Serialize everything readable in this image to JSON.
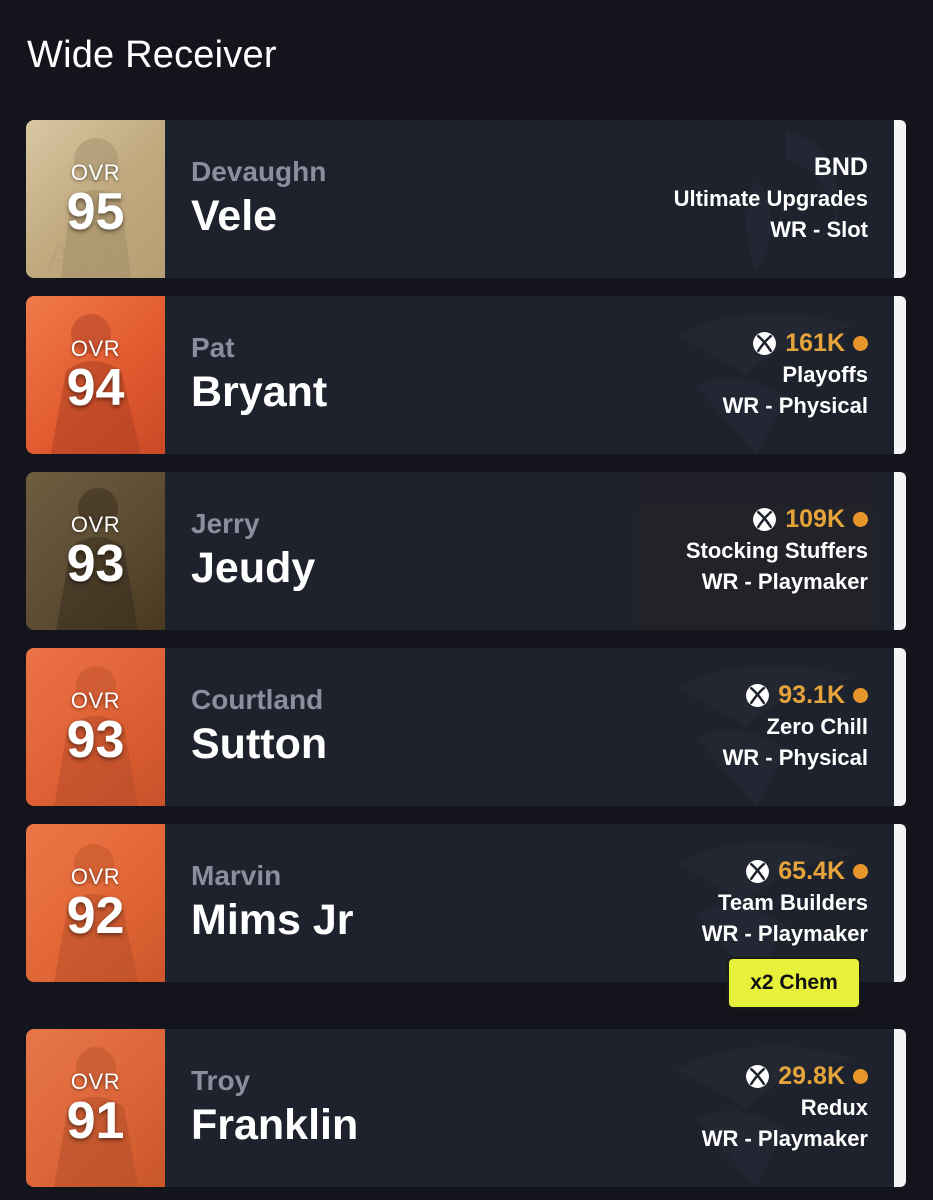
{
  "section_title": "Wide Receiver",
  "ovr_label": "OVR",
  "players": [
    {
      "ovr": "95",
      "first_name": "Devaughn",
      "last_name": "Vele",
      "top_text": "BND",
      "program": "Ultimate Upgrades",
      "archetype": "WR - Slot",
      "art_color": "#cbb793"
    },
    {
      "ovr": "94",
      "first_name": "Pat",
      "last_name": "Bryant",
      "price": "161K",
      "platform_icon": "xbox-icon",
      "currency_icon": "coin-icon",
      "program": "Playoffs",
      "archetype": "WR - Physical",
      "art_color": "#e8623a"
    },
    {
      "ovr": "93",
      "first_name": "Jerry",
      "last_name": "Jeudy",
      "price": "109K",
      "platform_icon": "xbox-icon",
      "currency_icon": "coin-icon",
      "program": "Stocking Stuffers",
      "archetype": "WR - Playmaker",
      "art_color": "#6c5a3e"
    },
    {
      "ovr": "93",
      "first_name": "Courtland",
      "last_name": "Sutton",
      "price": "93.1K",
      "platform_icon": "xbox-icon",
      "currency_icon": "coin-icon",
      "program": "Zero Chill",
      "archetype": "WR - Physical",
      "art_color": "#e06438"
    },
    {
      "ovr": "92",
      "first_name": "Marvin",
      "last_name": "Mims Jr",
      "price": "65.4K",
      "platform_icon": "xbox-icon",
      "currency_icon": "coin-icon",
      "program": "Team Builders",
      "archetype": "WR - Playmaker",
      "badge": "x2 Chem",
      "art_color": "#e26a35"
    },
    {
      "ovr": "91",
      "first_name": "Troy",
      "last_name": "Franklin",
      "price": "29.8K",
      "platform_icon": "xbox-icon",
      "currency_icon": "coin-icon",
      "program": "Redux",
      "archetype": "WR - Playmaker",
      "art_color": "#dc6a37"
    }
  ],
  "colors": {
    "background": "#14151c",
    "card": "#1e222c",
    "price": "#e5a33b",
    "coin": "#e8962b",
    "badge": "#e7f03a",
    "first_name": "#8a8f9e"
  }
}
